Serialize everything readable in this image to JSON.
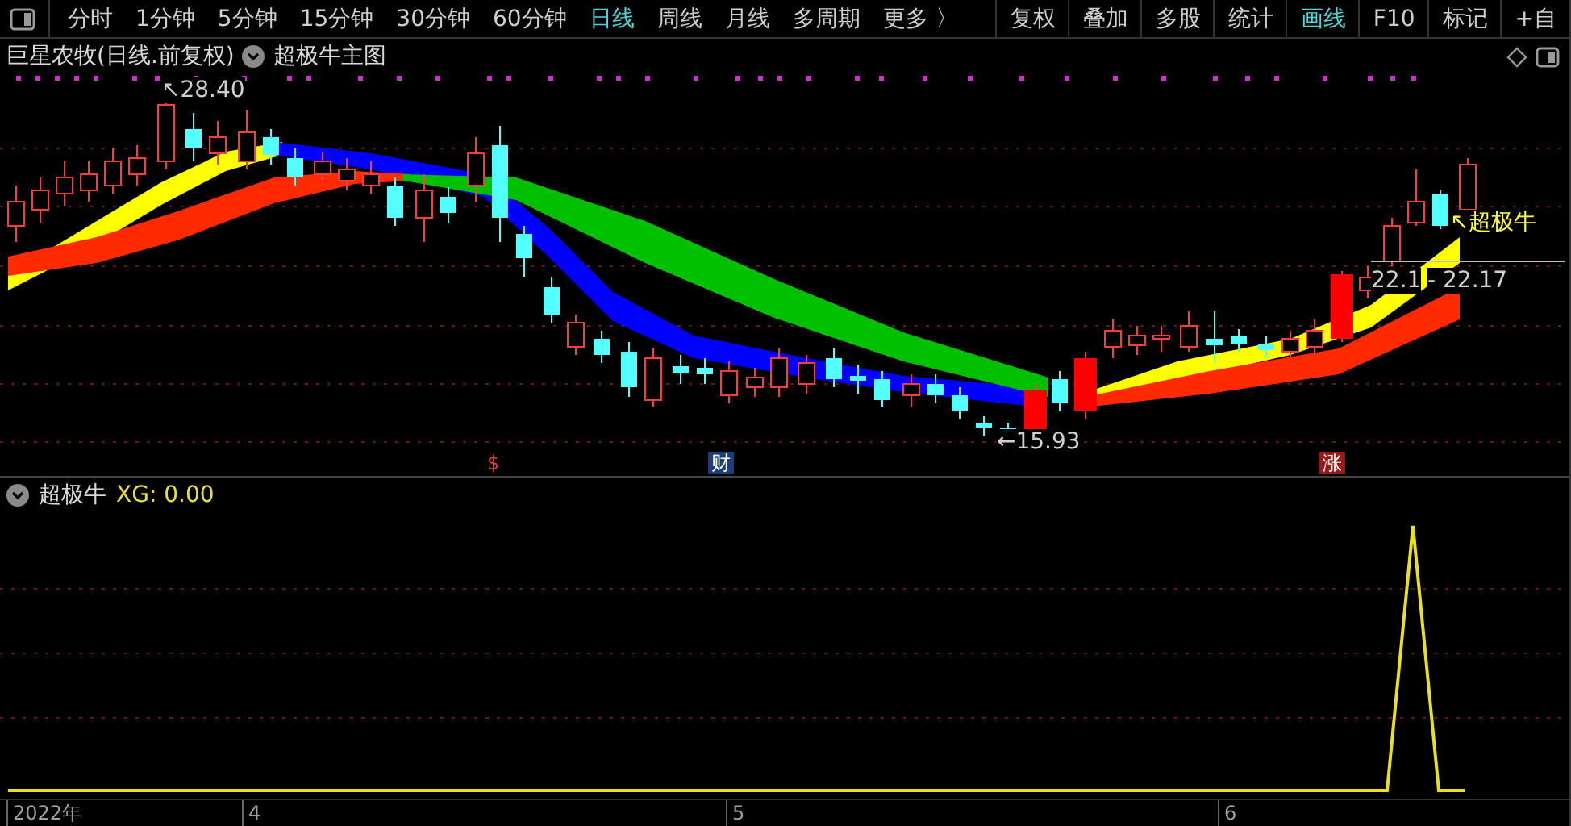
{
  "toolbar": {
    "periods": [
      {
        "label": "分时",
        "selected": false
      },
      {
        "label": "1分钟",
        "selected": false
      },
      {
        "label": "5分钟",
        "selected": false
      },
      {
        "label": "15分钟",
        "selected": false
      },
      {
        "label": "30分钟",
        "selected": false
      },
      {
        "label": "60分钟",
        "selected": false
      },
      {
        "label": "日线",
        "selected": true
      },
      {
        "label": "周线",
        "selected": false
      },
      {
        "label": "月线",
        "selected": false
      },
      {
        "label": "多周期",
        "selected": false
      },
      {
        "label": "更多 〉",
        "selected": false
      }
    ],
    "tools": [
      {
        "label": "复权",
        "selected": false
      },
      {
        "label": "叠加",
        "selected": false
      },
      {
        "label": "多股",
        "selected": false
      },
      {
        "label": "统计",
        "selected": false
      },
      {
        "label": "画线",
        "selected": true
      },
      {
        "label": "F10",
        "selected": false
      },
      {
        "label": "标记",
        "selected": false
      },
      {
        "label": "+自",
        "selected": false
      }
    ]
  },
  "main_chart": {
    "title": "巨星农牧(日线.前复权)",
    "indicator": "超极牛主图",
    "labels": [
      {
        "kind": "price",
        "text": "↖28.40"
      },
      {
        "kind": "price",
        "text": "←15.93"
      },
      {
        "kind": "price",
        "text": "22.1"
      },
      {
        "kind": "price",
        "text": "- 22.17"
      },
      {
        "kind": "signal",
        "text": "↖超极牛"
      }
    ],
    "events": [
      {
        "kind": "dollar",
        "text": "$"
      },
      {
        "kind": "finance",
        "text": "财"
      },
      {
        "kind": "rise",
        "text": "涨"
      }
    ]
  },
  "sub_chart": {
    "indicator": "超极牛",
    "value": "XG: 0.00"
  },
  "time_axis": [
    "2022年",
    "4",
    "5",
    "6"
  ]
}
